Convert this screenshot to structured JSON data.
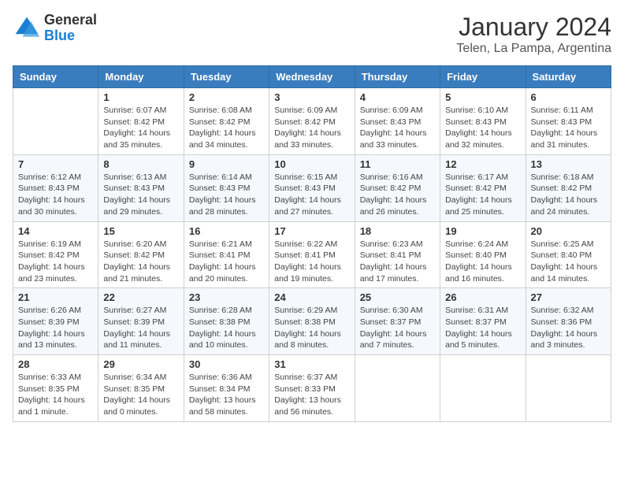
{
  "logo": {
    "general": "General",
    "blue": "Blue"
  },
  "title": "January 2024",
  "subtitle": "Telen, La Pampa, Argentina",
  "days_header": [
    "Sunday",
    "Monday",
    "Tuesday",
    "Wednesday",
    "Thursday",
    "Friday",
    "Saturday"
  ],
  "weeks": [
    [
      {
        "day": "",
        "info": ""
      },
      {
        "day": "1",
        "info": "Sunrise: 6:07 AM\nSunset: 8:42 PM\nDaylight: 14 hours\nand 35 minutes."
      },
      {
        "day": "2",
        "info": "Sunrise: 6:08 AM\nSunset: 8:42 PM\nDaylight: 14 hours\nand 34 minutes."
      },
      {
        "day": "3",
        "info": "Sunrise: 6:09 AM\nSunset: 8:42 PM\nDaylight: 14 hours\nand 33 minutes."
      },
      {
        "day": "4",
        "info": "Sunrise: 6:09 AM\nSunset: 8:43 PM\nDaylight: 14 hours\nand 33 minutes."
      },
      {
        "day": "5",
        "info": "Sunrise: 6:10 AM\nSunset: 8:43 PM\nDaylight: 14 hours\nand 32 minutes."
      },
      {
        "day": "6",
        "info": "Sunrise: 6:11 AM\nSunset: 8:43 PM\nDaylight: 14 hours\nand 31 minutes."
      }
    ],
    [
      {
        "day": "7",
        "info": "Sunrise: 6:12 AM\nSunset: 8:43 PM\nDaylight: 14 hours\nand 30 minutes."
      },
      {
        "day": "8",
        "info": "Sunrise: 6:13 AM\nSunset: 8:43 PM\nDaylight: 14 hours\nand 29 minutes."
      },
      {
        "day": "9",
        "info": "Sunrise: 6:14 AM\nSunset: 8:43 PM\nDaylight: 14 hours\nand 28 minutes."
      },
      {
        "day": "10",
        "info": "Sunrise: 6:15 AM\nSunset: 8:43 PM\nDaylight: 14 hours\nand 27 minutes."
      },
      {
        "day": "11",
        "info": "Sunrise: 6:16 AM\nSunset: 8:42 PM\nDaylight: 14 hours\nand 26 minutes."
      },
      {
        "day": "12",
        "info": "Sunrise: 6:17 AM\nSunset: 8:42 PM\nDaylight: 14 hours\nand 25 minutes."
      },
      {
        "day": "13",
        "info": "Sunrise: 6:18 AM\nSunset: 8:42 PM\nDaylight: 14 hours\nand 24 minutes."
      }
    ],
    [
      {
        "day": "14",
        "info": "Sunrise: 6:19 AM\nSunset: 8:42 PM\nDaylight: 14 hours\nand 23 minutes."
      },
      {
        "day": "15",
        "info": "Sunrise: 6:20 AM\nSunset: 8:42 PM\nDaylight: 14 hours\nand 21 minutes."
      },
      {
        "day": "16",
        "info": "Sunrise: 6:21 AM\nSunset: 8:41 PM\nDaylight: 14 hours\nand 20 minutes."
      },
      {
        "day": "17",
        "info": "Sunrise: 6:22 AM\nSunset: 8:41 PM\nDaylight: 14 hours\nand 19 minutes."
      },
      {
        "day": "18",
        "info": "Sunrise: 6:23 AM\nSunset: 8:41 PM\nDaylight: 14 hours\nand 17 minutes."
      },
      {
        "day": "19",
        "info": "Sunrise: 6:24 AM\nSunset: 8:40 PM\nDaylight: 14 hours\nand 16 minutes."
      },
      {
        "day": "20",
        "info": "Sunrise: 6:25 AM\nSunset: 8:40 PM\nDaylight: 14 hours\nand 14 minutes."
      }
    ],
    [
      {
        "day": "21",
        "info": "Sunrise: 6:26 AM\nSunset: 8:39 PM\nDaylight: 14 hours\nand 13 minutes."
      },
      {
        "day": "22",
        "info": "Sunrise: 6:27 AM\nSunset: 8:39 PM\nDaylight: 14 hours\nand 11 minutes."
      },
      {
        "day": "23",
        "info": "Sunrise: 6:28 AM\nSunset: 8:38 PM\nDaylight: 14 hours\nand 10 minutes."
      },
      {
        "day": "24",
        "info": "Sunrise: 6:29 AM\nSunset: 8:38 PM\nDaylight: 14 hours\nand 8 minutes."
      },
      {
        "day": "25",
        "info": "Sunrise: 6:30 AM\nSunset: 8:37 PM\nDaylight: 14 hours\nand 7 minutes."
      },
      {
        "day": "26",
        "info": "Sunrise: 6:31 AM\nSunset: 8:37 PM\nDaylight: 14 hours\nand 5 minutes."
      },
      {
        "day": "27",
        "info": "Sunrise: 6:32 AM\nSunset: 8:36 PM\nDaylight: 14 hours\nand 3 minutes."
      }
    ],
    [
      {
        "day": "28",
        "info": "Sunrise: 6:33 AM\nSunset: 8:35 PM\nDaylight: 14 hours\nand 1 minute."
      },
      {
        "day": "29",
        "info": "Sunrise: 6:34 AM\nSunset: 8:35 PM\nDaylight: 14 hours\nand 0 minutes."
      },
      {
        "day": "30",
        "info": "Sunrise: 6:36 AM\nSunset: 8:34 PM\nDaylight: 13 hours\nand 58 minutes."
      },
      {
        "day": "31",
        "info": "Sunrise: 6:37 AM\nSunset: 8:33 PM\nDaylight: 13 hours\nand 56 minutes."
      },
      {
        "day": "",
        "info": ""
      },
      {
        "day": "",
        "info": ""
      },
      {
        "day": "",
        "info": ""
      }
    ]
  ]
}
